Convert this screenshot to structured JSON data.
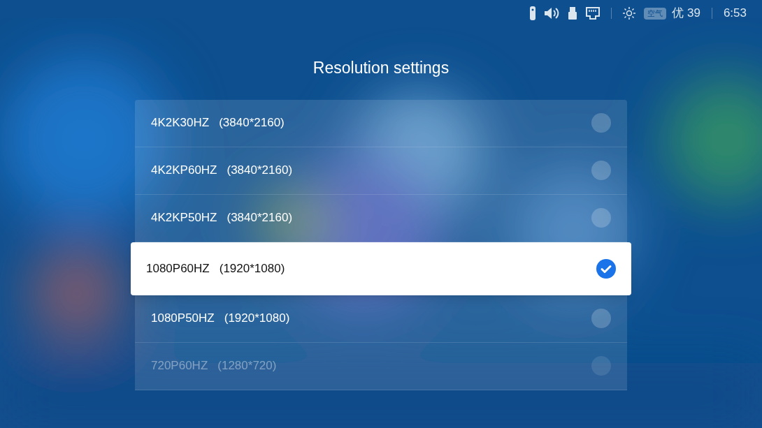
{
  "status_bar": {
    "air_badge": "空气",
    "air_quality": "优 39",
    "time": "6:53"
  },
  "title": "Resolution settings",
  "options": [
    {
      "mode": "4K2K30HZ",
      "resolution": "(3840*2160)",
      "selected": false,
      "dimmed": false
    },
    {
      "mode": "4K2KP60HZ",
      "resolution": "(3840*2160)",
      "selected": false,
      "dimmed": false
    },
    {
      "mode": "4K2KP50HZ",
      "resolution": "(3840*2160)",
      "selected": false,
      "dimmed": false
    },
    {
      "mode": "1080P60HZ",
      "resolution": "(1920*1080)",
      "selected": true,
      "dimmed": false
    },
    {
      "mode": "1080P50HZ",
      "resolution": "(1920*1080)",
      "selected": false,
      "dimmed": false
    },
    {
      "mode": "720P60HZ",
      "resolution": "(1280*720)",
      "selected": false,
      "dimmed": true
    }
  ]
}
